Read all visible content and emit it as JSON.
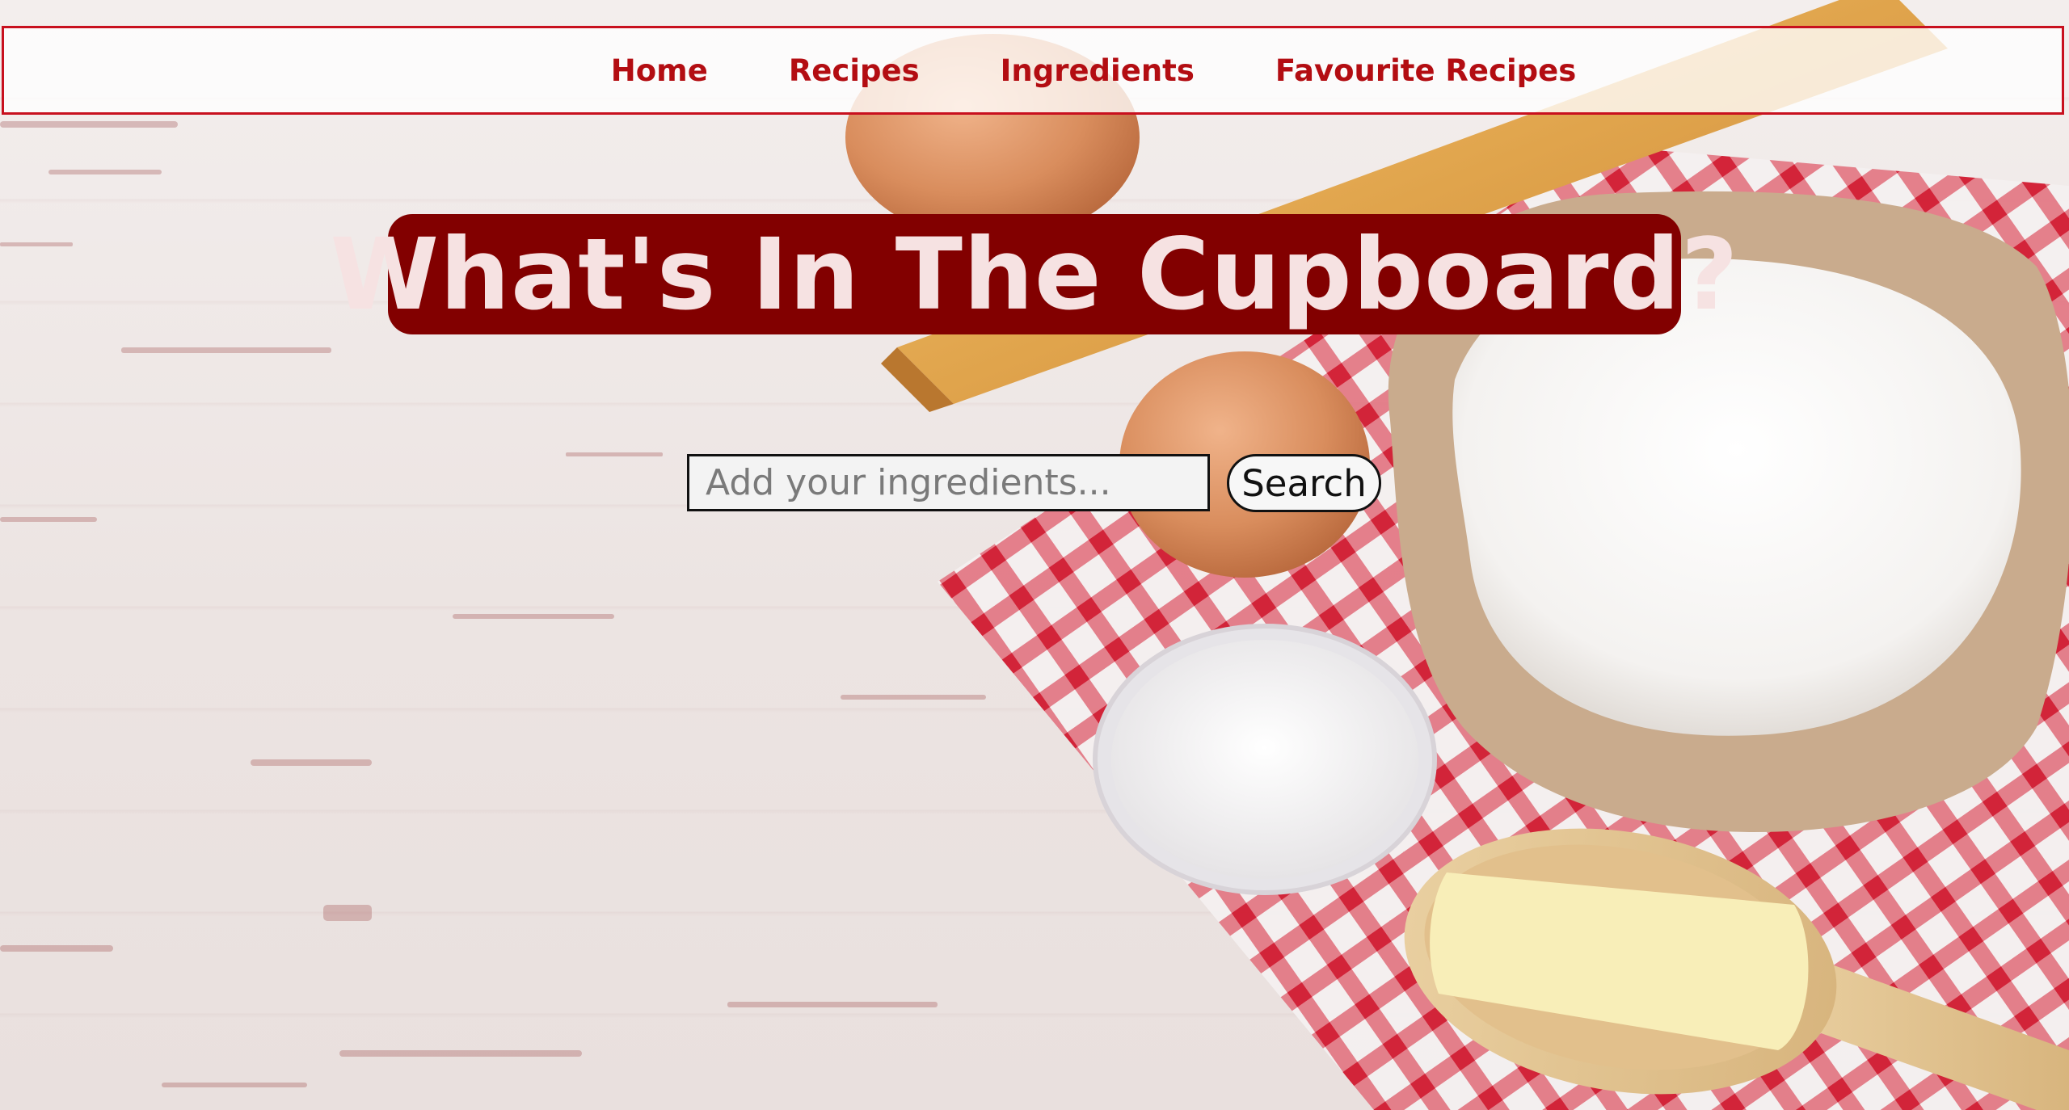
{
  "nav": {
    "items": [
      {
        "label": "Home"
      },
      {
        "label": "Recipes"
      },
      {
        "label": "Ingredients"
      },
      {
        "label": "Favourite Recipes"
      }
    ]
  },
  "hero": {
    "title": "What's In The Cupboard?"
  },
  "search": {
    "placeholder": "Add your ingredients...",
    "value": "",
    "button_label": "Search"
  },
  "colors": {
    "accent": "#b30d12",
    "title_background": "#820000",
    "title_text": "#f6e2e2",
    "nav_border": "#c8101e"
  },
  "icons": [
    "rolling-pin-icon",
    "egg-icon",
    "flour-bag-icon",
    "sugar-bowl-icon",
    "butter-spoon-icon",
    "checkered-cloth-icon"
  ]
}
